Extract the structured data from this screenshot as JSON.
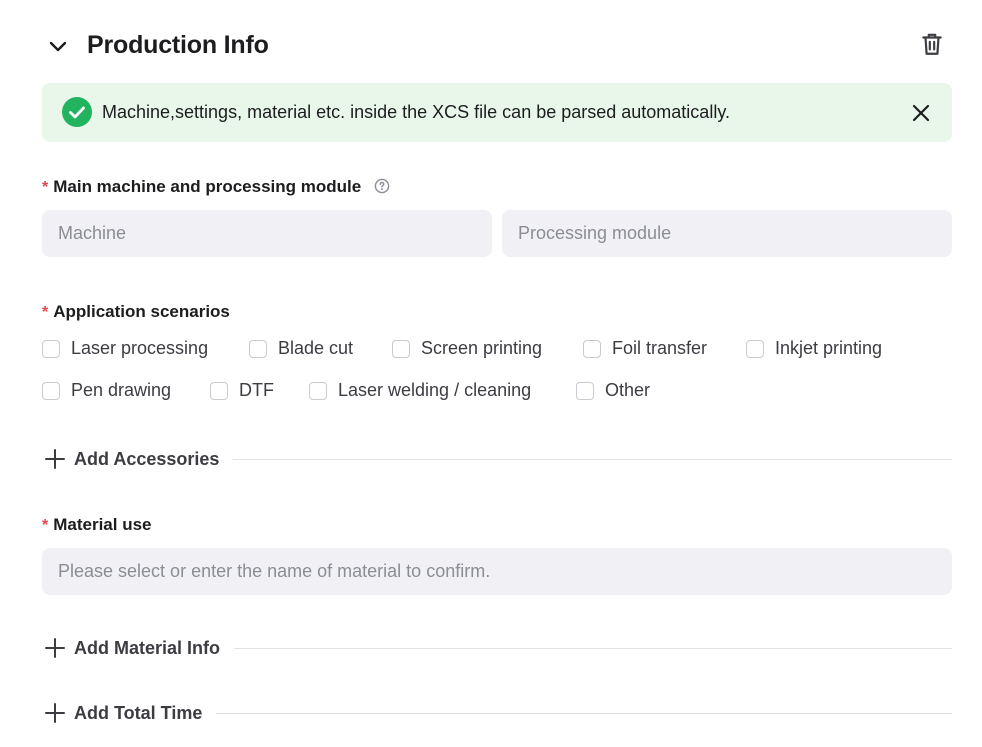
{
  "section": {
    "title": "Production Info"
  },
  "banner": {
    "message": "Machine,settings, material etc. inside the XCS file can be parsed automatically."
  },
  "machine": {
    "label": "Main machine and processing module",
    "required_mark": "*",
    "machine_placeholder": "Machine",
    "module_placeholder": "Processing module"
  },
  "scenarios": {
    "label": "Application scenarios",
    "required_mark": "*",
    "options": [
      "Laser processing",
      "Blade cut",
      "Screen printing",
      "Foil transfer",
      "Inkjet printing",
      "Pen drawing",
      "DTF",
      "Laser welding / cleaning",
      "Other"
    ]
  },
  "accessories": {
    "add_label": "Add Accessories"
  },
  "material": {
    "label": "Material use",
    "required_mark": "*",
    "placeholder": "Please select or enter the name of material to confirm.",
    "add_info_label": "Add Material Info"
  },
  "total_time": {
    "add_label": "Add Total Time"
  },
  "colors": {
    "success": "#22b35e",
    "banner_bg": "#e8f7ea",
    "required": "#e5484d",
    "input_bg": "#f1f1f5"
  }
}
